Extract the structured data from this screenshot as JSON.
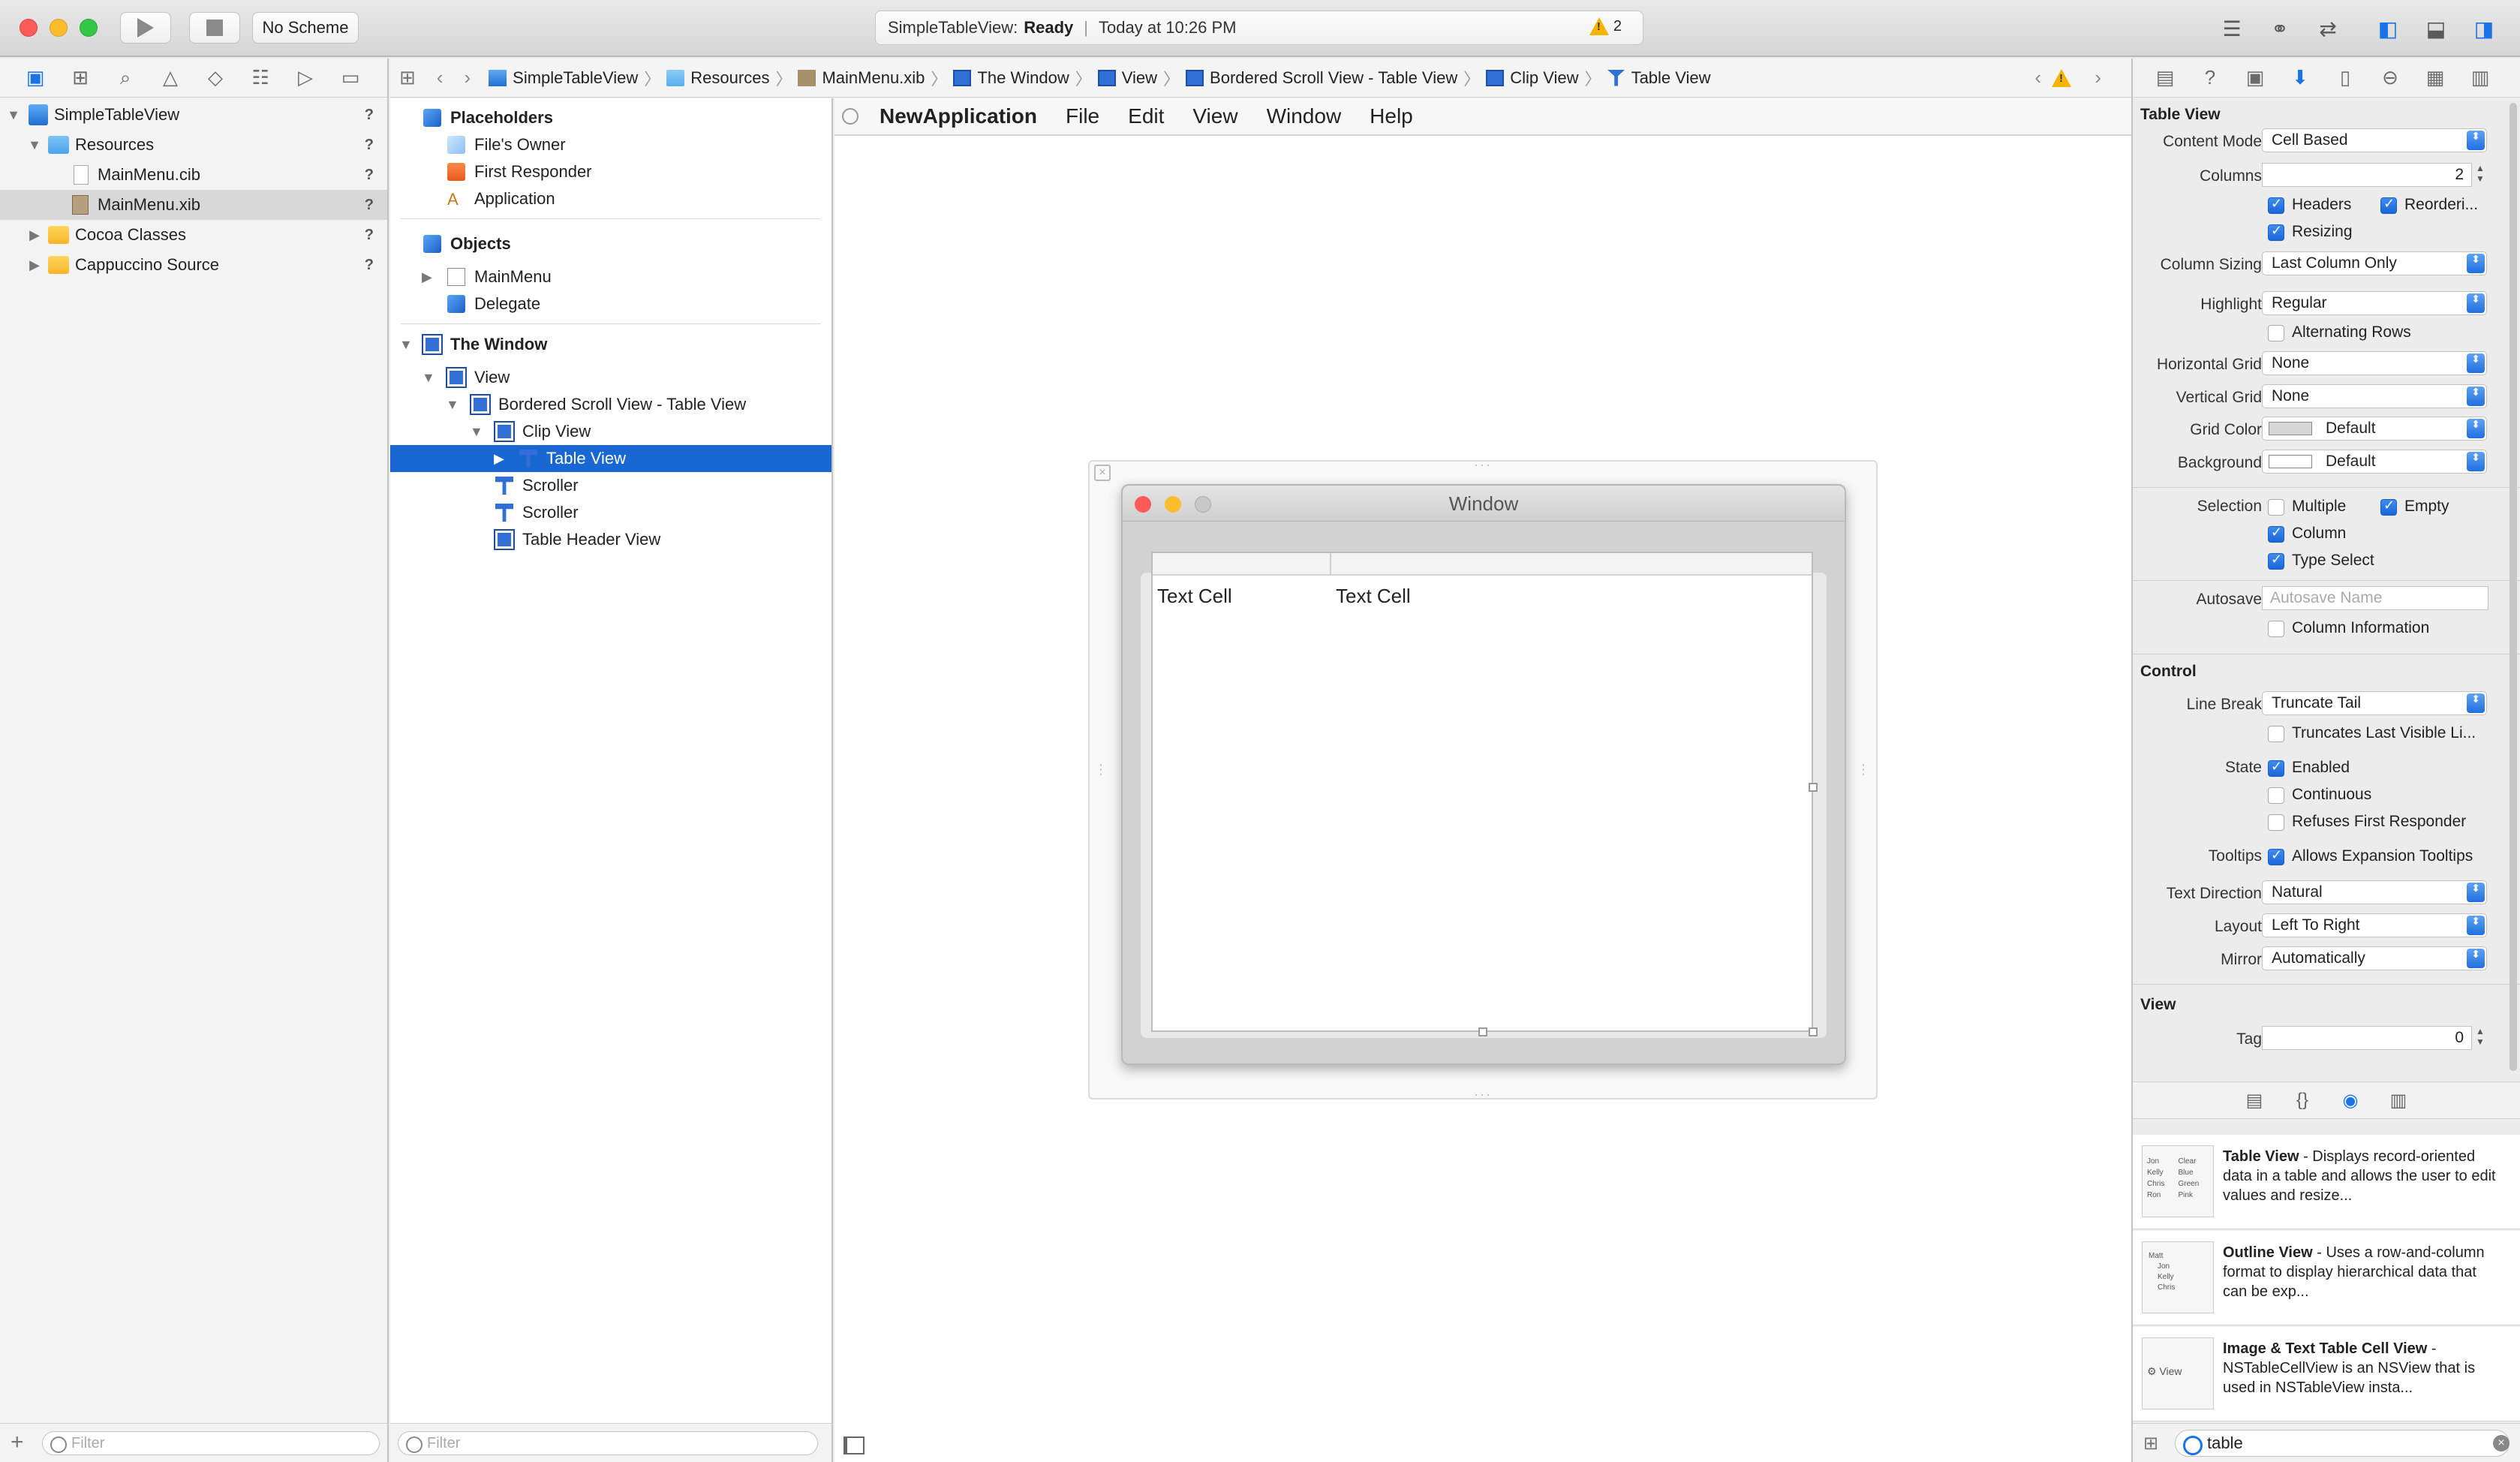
{
  "toolbar": {
    "scheme": "No Scheme",
    "activity_project": "SimpleTableView:",
    "activity_status": "Ready",
    "activity_time": "Today at 10:26 PM",
    "warning_count": "2"
  },
  "navigator": {
    "items": [
      {
        "label": "SimpleTableView",
        "badge": "?"
      },
      {
        "label": "Resources",
        "badge": "?"
      },
      {
        "label": "MainMenu.cib",
        "badge": "?"
      },
      {
        "label": "MainMenu.xib",
        "badge": "?"
      },
      {
        "label": "Cocoa Classes",
        "badge": "?"
      },
      {
        "label": "Cappuccino Source",
        "badge": "?"
      }
    ],
    "filter_placeholder": "Filter"
  },
  "jumpbar": {
    "items": [
      "SimpleTableView",
      "Resources",
      "MainMenu.xib",
      "The Window",
      "View",
      "Bordered Scroll View - Table View",
      "Clip View",
      "Table View"
    ]
  },
  "outline": {
    "placeholders_title": "Placeholders",
    "files_owner": "File's Owner",
    "first_responder": "First Responder",
    "application": "Application",
    "objects_title": "Objects",
    "main_menu": "MainMenu",
    "delegate": "Delegate",
    "window_title": "The Window",
    "view": "View",
    "bordered_scroll": "Bordered Scroll View - Table View",
    "clip_view": "Clip View",
    "table_view": "Table View",
    "scroller1": "Scroller",
    "scroller2": "Scroller",
    "table_header": "Table Header View",
    "filter_placeholder": "Filter"
  },
  "canvas": {
    "menubar": {
      "app": "NewApplication",
      "items": [
        "File",
        "Edit",
        "View",
        "Window",
        "Help"
      ]
    },
    "window_title": "Window",
    "cells": [
      "Text Cell",
      "Text Cell"
    ]
  },
  "inspector": {
    "table_view_title": "Table View",
    "content_mode_label": "Content Mode",
    "content_mode": "Cell Based",
    "columns_label": "Columns",
    "columns": "2",
    "headers": "Headers",
    "reordering": "Reorderi...",
    "resizing": "Resizing",
    "column_sizing_label": "Column Sizing",
    "column_sizing": "Last Column Only",
    "highlight_label": "Highlight",
    "highlight": "Regular",
    "alternating_rows": "Alternating Rows",
    "horizontal_grid_label": "Horizontal Grid",
    "horizontal_grid": "None",
    "vertical_grid_label": "Vertical Grid",
    "vertical_grid": "None",
    "grid_color_label": "Grid Color",
    "grid_color": "Default",
    "background_label": "Background",
    "background": "Default",
    "selection_label": "Selection",
    "multiple": "Multiple",
    "empty": "Empty",
    "column": "Column",
    "type_select": "Type Select",
    "autosave_label": "Autosave",
    "autosave_placeholder": "Autosave Name",
    "column_information": "Column Information",
    "control_title": "Control",
    "line_break_label": "Line Break",
    "line_break": "Truncate Tail",
    "truncates_last": "Truncates Last Visible Li...",
    "state_label": "State",
    "enabled": "Enabled",
    "continuous": "Continuous",
    "refuses_first_responder": "Refuses First Responder",
    "tooltips_label": "Tooltips",
    "allows_expansion_tooltips": "Allows Expansion Tooltips",
    "text_direction_label": "Text Direction",
    "text_direction": "Natural",
    "layout_label": "Layout",
    "layout": "Left To Right",
    "mirror_label": "Mirror",
    "mirror": "Automatically",
    "view_title": "View",
    "tag_label": "Tag",
    "tag": "0"
  },
  "library": {
    "items": [
      {
        "title": "Table View",
        "desc": " - Displays record-oriented data in a table and allows the user to edit values and resize..."
      },
      {
        "title": "Outline View",
        "desc": " - Uses a row-and-column format to display hierarchical data that can be exp..."
      },
      {
        "title": "Image & Text Table Cell View",
        "desc": " - NSTableCellView is an NSView that is used in NSTableView insta..."
      }
    ],
    "thumb1": [
      "Jon",
      "Clear",
      "Kelly",
      "Blue",
      "Chris",
      "Green",
      "Ron",
      "Pink"
    ],
    "thumb2": [
      "Matt",
      "Jon",
      "Kelly",
      "Chris"
    ],
    "thumb3": "View",
    "search_value": "table"
  }
}
